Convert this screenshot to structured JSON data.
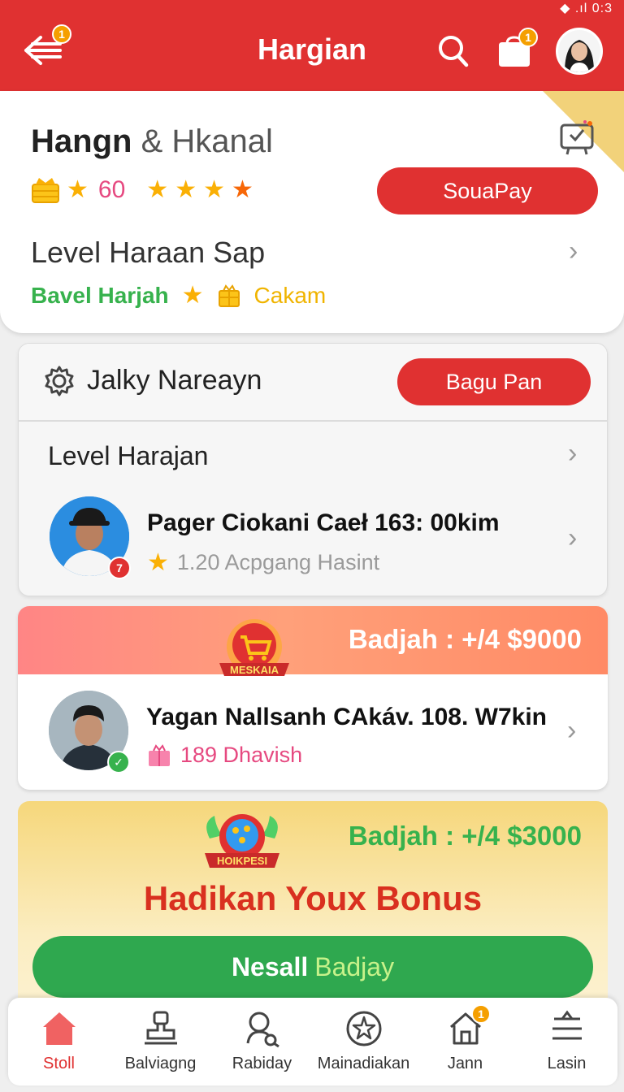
{
  "status_bar": {
    "text": "◆ .ıl 0:3"
  },
  "header": {
    "title": "Hargian",
    "back_badge": "1",
    "bag_badge": "1"
  },
  "profile": {
    "name_first": "Hangn",
    "name_amp": "&",
    "name_last": "Hkanal",
    "rating_value": "60",
    "pay_button": "SouaPay",
    "level_title": "Level Haraan Sap",
    "level_green": "Bavel Harjah",
    "level_gold": "Cakam"
  },
  "card_referral": {
    "title": "Jalky Nareayn",
    "button": "Bagu Pan",
    "level_label": "Level Harajan",
    "person": {
      "name": "Pager Ciokani Caeł 163: 00kim",
      "subtitle": "1.20 Acpgang Hasint",
      "badge": "7"
    }
  },
  "card_badge1": {
    "band_label": "Badjah : +/4 $9000",
    "emblem_text": "MESKAIA",
    "person": {
      "name": "Yagan Nallsanh CAkáv. 108. W7kin",
      "subtitle": "189 Dhavish"
    }
  },
  "bonus_card": {
    "band_label": "Badjah : +/4 $3000",
    "emblem_text": "HOIKPESI",
    "title": "Hadikan Youx Bonus",
    "button_bold": "Nesall",
    "button_light": "Badjay"
  },
  "bottom_nav": {
    "items": [
      {
        "label": "Stoll",
        "icon": "home-icon",
        "active": true
      },
      {
        "label": "Balviagng",
        "icon": "stamp-icon"
      },
      {
        "label": "Rabiday",
        "icon": "search-person-icon"
      },
      {
        "label": "Mainadiakan",
        "icon": "star-globe-icon"
      },
      {
        "label": "Jann",
        "icon": "house-outline-icon",
        "badge": "1"
      },
      {
        "label": "Lasin",
        "icon": "menu-icon"
      }
    ]
  },
  "colors": {
    "primary_red": "#e03131",
    "accent_green": "#37b24d",
    "gold": "#fab005",
    "badge_orange": "#f59f00"
  }
}
